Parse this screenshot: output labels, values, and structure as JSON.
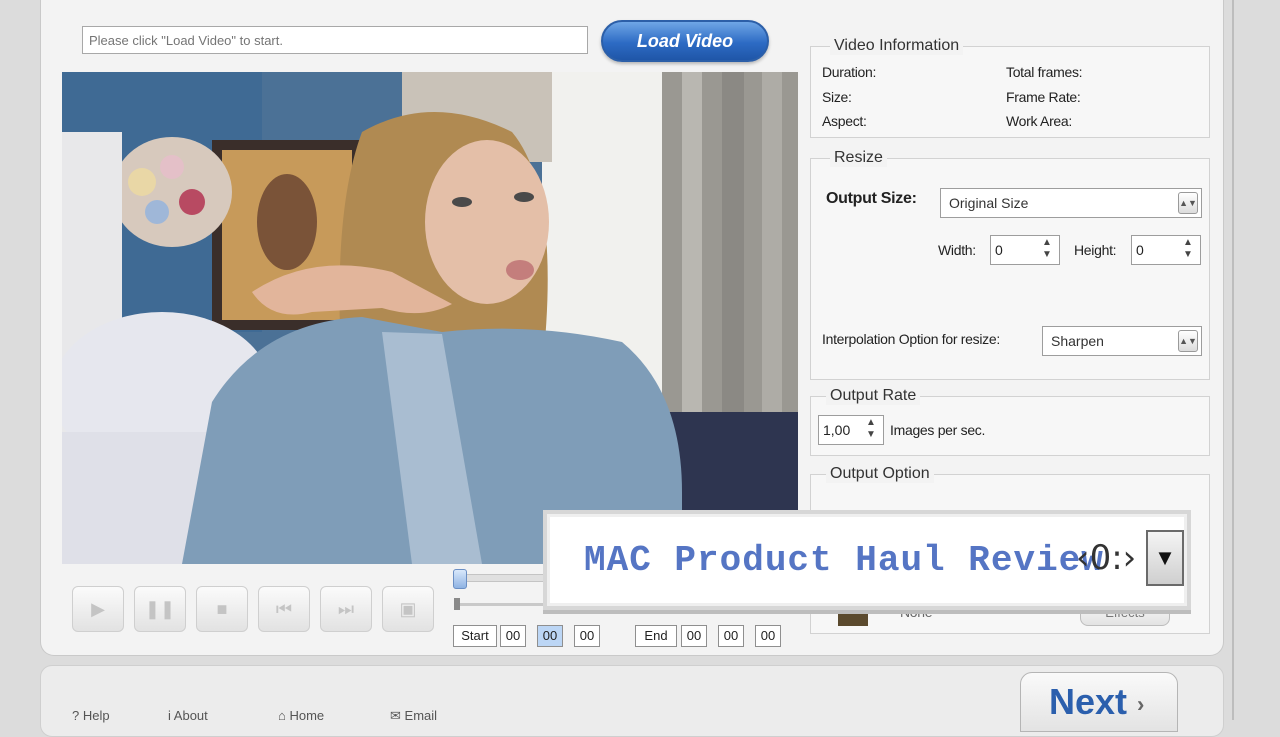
{
  "path": {
    "placeholder": "Please click \"Load Video\" to start."
  },
  "load_button": "Load Video",
  "video_info": {
    "title": "Video Information",
    "duration": "Duration:",
    "size": "Size:",
    "aspect": "Aspect:",
    "total_frames": "Total frames:",
    "frame_rate": "Frame Rate:",
    "work_area": "Work Area:"
  },
  "resize": {
    "title": "Resize",
    "output_size_label": "Output Size:",
    "output_size_value": "Original Size",
    "width_label": "Width:",
    "width_value": "0",
    "height_label": "Height:",
    "height_value": "0",
    "interp_label": "Interpolation Option for resize:",
    "interp_value": "Sharpen"
  },
  "output_rate": {
    "title": "Output Rate",
    "value": "1,00",
    "unit": "Images per sec."
  },
  "output_option": {
    "title": "Output Option",
    "effect_value": "None",
    "effects_button": "Effects"
  },
  "timeline": {
    "start_label": "Start",
    "end_label": "End",
    "start": [
      "00",
      "00",
      "00"
    ],
    "end": [
      "00",
      "00",
      "00"
    ]
  },
  "overlay": {
    "title": "MAC Product Haul Review",
    "symbol": "‹0:›"
  },
  "footer": {
    "help": "Help",
    "about": "About",
    "home": "Home",
    "email": "Email"
  },
  "next_button": "Next",
  "colors": {
    "accent": "#2d6bc4",
    "overlay_text": "#5575c4",
    "next_text": "#2b5fad"
  }
}
